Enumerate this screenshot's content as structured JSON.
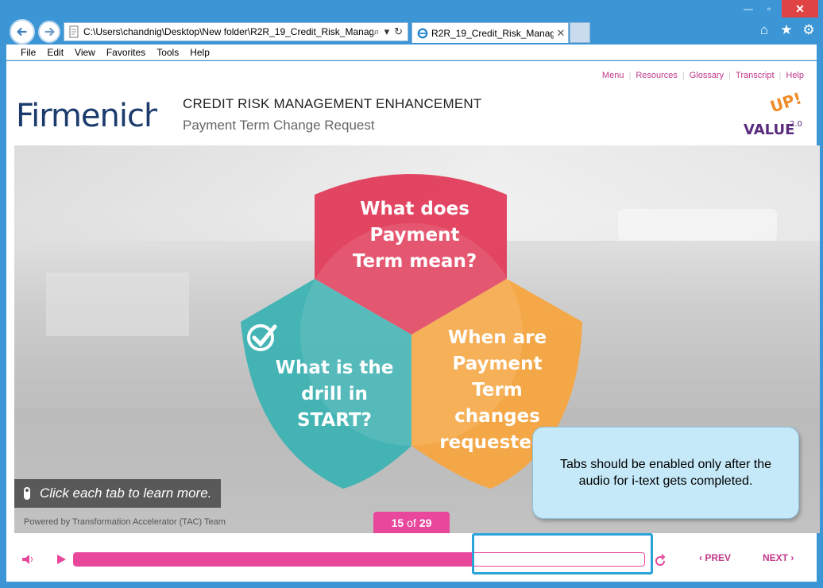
{
  "browser": {
    "address": "C:\\Users\\chandnig\\Desktop\\New folder\\R2R_19_Credit_Risk_Manag",
    "tab_title": "R2R_19_Credit_Risk_Manag...",
    "tab_close": "✕",
    "close_glyph": "✕",
    "menu": [
      "File",
      "Edit",
      "View",
      "Favorites",
      "Tools",
      "Help"
    ]
  },
  "toplinks": [
    "Menu",
    "Resources",
    "Glossary",
    "Transcript",
    "Help"
  ],
  "header": {
    "brand": "Firmenich",
    "title": "CREDIT RISK MANAGEMENT ENHANCEMENT",
    "subtitle": "Payment Term Change Request",
    "value_logo_top": "UP!",
    "value_logo_main": "VALUE",
    "value_logo_sup": "2.0"
  },
  "petals": {
    "top": "What does Payment Term mean?",
    "left": "What is the drill in START?",
    "right": "When are Payment Term changes requested?"
  },
  "hint": "Click each tab to learn more.",
  "powered": "Powered by Transformation Accelerator (TAC) Team",
  "page": {
    "current": "15",
    "of": "of",
    "total": "29"
  },
  "callout": "Tabs should be enabled only after the audio for i-text gets completed.",
  "controls": {
    "prev": "PREV",
    "next": "NEXT",
    "progress": 0.7
  },
  "colors": {
    "accent": "#e8479c",
    "red": "#e23c5a",
    "teal": "#3fb3b4",
    "orange": "#f7a53f",
    "callout": "#c5e9f8"
  }
}
